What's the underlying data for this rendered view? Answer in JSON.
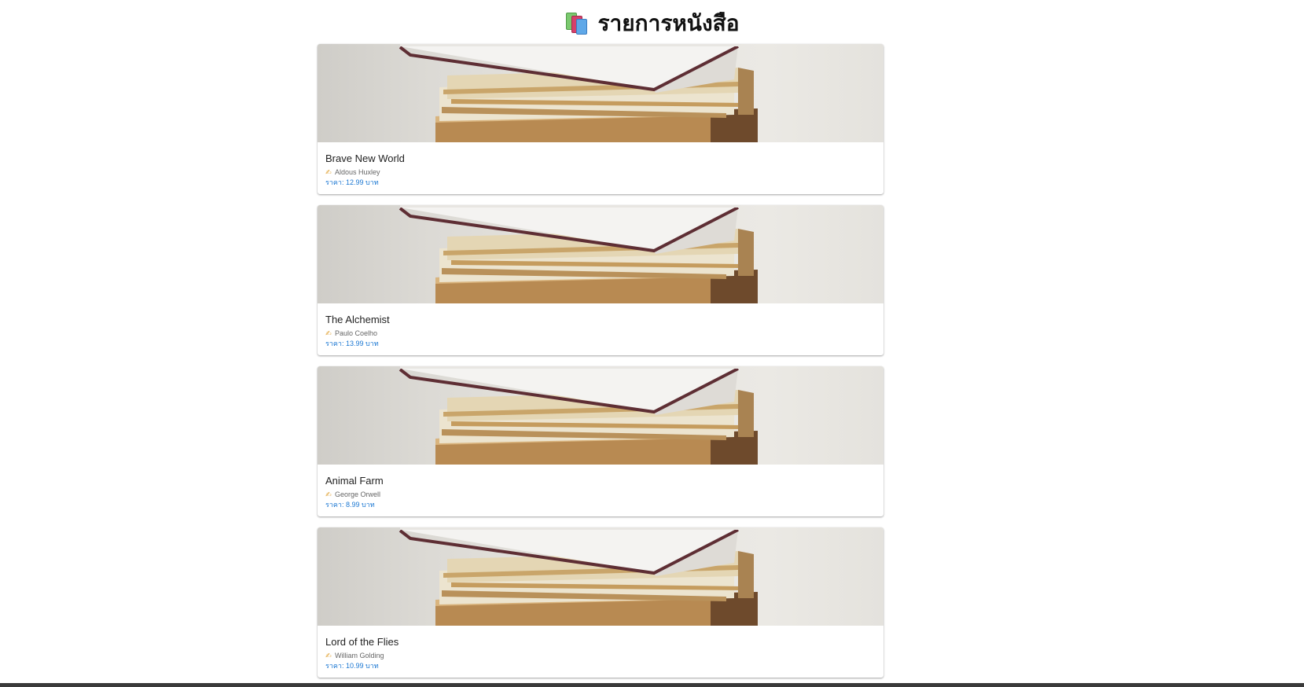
{
  "header": {
    "title": "รายการหนังสือ",
    "icon": "books-icon"
  },
  "price_label": "ราคา:",
  "currency": "บาท",
  "books": [
    {
      "title": "Brave New World",
      "author": "Aldous Huxley",
      "price": "12.99"
    },
    {
      "title": "The Alchemist",
      "author": "Paulo Coelho",
      "price": "13.99"
    },
    {
      "title": "Animal Farm",
      "author": "George Orwell",
      "price": "8.99"
    },
    {
      "title": "Lord of the Flies",
      "author": "William Golding",
      "price": "10.99"
    }
  ],
  "colors": {
    "price": "#1976d2",
    "title": "#212121",
    "author": "#666666"
  }
}
